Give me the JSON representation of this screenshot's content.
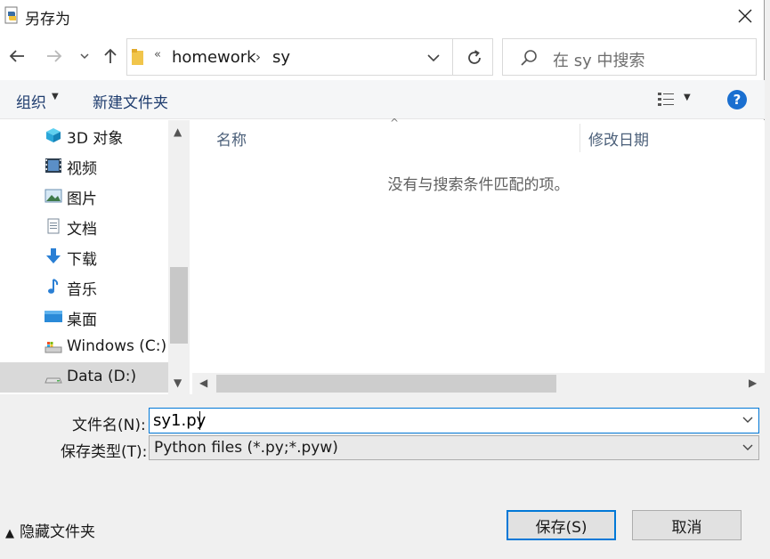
{
  "window": {
    "title": "另存为"
  },
  "nav": {
    "back_icon": "arrow-left-icon",
    "forward_icon": "arrow-right-icon",
    "up_icon": "arrow-up-icon"
  },
  "address": {
    "overflow": "«",
    "segments": [
      "homework",
      "sy"
    ],
    "separator": "›"
  },
  "search": {
    "placeholder": "在 sy 中搜索"
  },
  "toolbar": {
    "organize": "组织",
    "new_folder": "新建文件夹",
    "help": "?"
  },
  "sidebar": {
    "items": [
      {
        "label": "3D 对象",
        "icon": "3d-objects-icon"
      },
      {
        "label": "视频",
        "icon": "video-icon"
      },
      {
        "label": "图片",
        "icon": "pictures-icon"
      },
      {
        "label": "文档",
        "icon": "documents-icon"
      },
      {
        "label": "下载",
        "icon": "download-icon"
      },
      {
        "label": "音乐",
        "icon": "music-icon"
      },
      {
        "label": "桌面",
        "icon": "desktop-icon"
      },
      {
        "label": "Windows (C:)",
        "icon": "drive-icon"
      },
      {
        "label": "Data (D:)",
        "icon": "drive-icon",
        "selected": true
      }
    ]
  },
  "filelist": {
    "columns": [
      "名称",
      "修改日期"
    ],
    "empty_message": "没有与搜索条件匹配的项。"
  },
  "form": {
    "filename_label": "文件名(N):",
    "filename_value": "sy1.py",
    "filetype_label": "保存类型(T):",
    "filetype_value": "Python files (*.py;*.pyw)"
  },
  "footer": {
    "hide_folders": "隐藏文件夹",
    "save": "保存(S)",
    "cancel": "取消"
  },
  "colors": {
    "accent": "#0078d7",
    "help": "#1a6fd0",
    "selected_row": "#d9d9d9"
  }
}
